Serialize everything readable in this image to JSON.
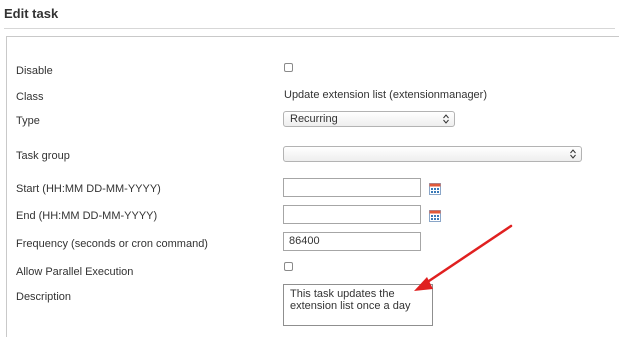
{
  "header": {
    "title": "Edit task"
  },
  "form": {
    "disable": {
      "label": "Disable"
    },
    "class": {
      "label": "Class",
      "value": "Update extension list (extensionmanager)"
    },
    "type": {
      "label": "Type",
      "selected": "Recurring"
    },
    "task_group": {
      "label": "Task group",
      "selected": ""
    },
    "start": {
      "label": "Start (HH:MM DD-MM-YYYY)",
      "value": ""
    },
    "end": {
      "label": "End (HH:MM DD-MM-YYYY)",
      "value": ""
    },
    "frequency": {
      "label": "Frequency (seconds or cron command)",
      "value": "86400"
    },
    "parallel": {
      "label": "Allow Parallel Execution"
    },
    "description": {
      "label": "Description",
      "value": "This task updates the extension list once a day"
    }
  },
  "colors": {
    "annotation_arrow": "#e02020",
    "calendar_icon": "#3a7ab8"
  },
  "icons": [
    "calendar-icon",
    "select-arrows-icon",
    "annotation-arrow"
  ]
}
